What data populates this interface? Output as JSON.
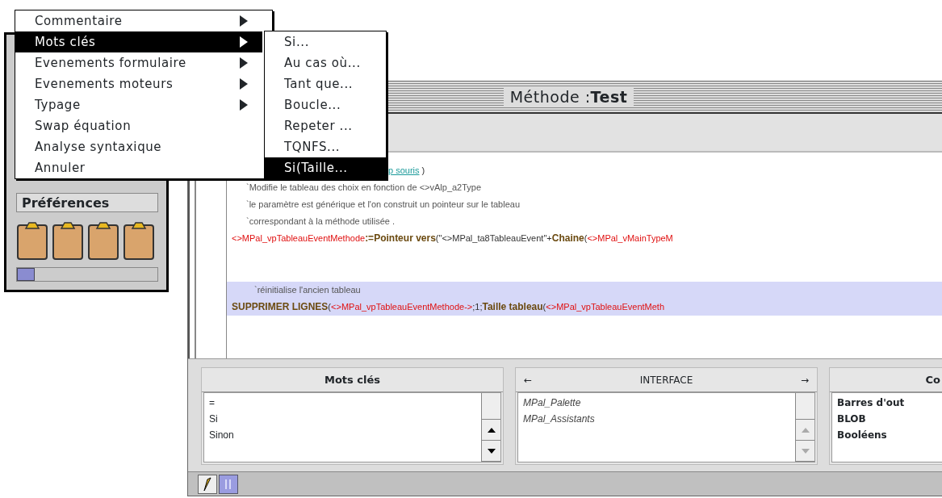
{
  "palette": {
    "title": "Préférences",
    "tools": [
      {
        "kind": "clipboard"
      },
      {
        "kind": "clipboard"
      },
      {
        "kind": "clipboard"
      },
      {
        "kind": "clipboard"
      }
    ]
  },
  "method_window": {
    "title_prefix": "Méthode :",
    "title_name": "Test",
    "code_lines": [
      {
        "kind": "code",
        "highlighted": false,
        "segments": [
          {
            "kind": "link",
            "text": "p souris"
          },
          {
            "kind": "plain",
            "text": " )"
          }
        ]
      },
      {
        "kind": "comment",
        "highlighted": false,
        "segments": [
          {
            "kind": "comment",
            "text": "`Modifie le tableau des choix en fonction de  <>vAlp_a2Type"
          }
        ]
      },
      {
        "kind": "comment",
        "highlighted": false,
        "segments": [
          {
            "kind": "comment",
            "text": "`le paramètre est générique et l'on construit un pointeur sur le tableau"
          }
        ]
      },
      {
        "kind": "comment",
        "highlighted": false,
        "segments": [
          {
            "kind": "comment",
            "text": "`correspondant à la méthode utilisée ."
          }
        ]
      },
      {
        "kind": "code",
        "highlighted": false,
        "segments": [
          {
            "kind": "variable",
            "text": "<>MPal_vpTableauEventMethode"
          },
          {
            "kind": "keyword",
            "text": ":=Pointeur vers"
          },
          {
            "kind": "plain",
            "text": "(\"<>MPal_ta8TableauEvent\"+"
          },
          {
            "kind": "keyword",
            "text": "Chaine"
          },
          {
            "kind": "plain",
            "text": "("
          },
          {
            "kind": "variable",
            "text": "<>MPal_vMainTypeM"
          }
        ]
      },
      {
        "kind": "comment",
        "highlighted": true,
        "segments": [
          {
            "kind": "comment",
            "text": "`réinitialise l'ancien tableau"
          }
        ]
      },
      {
        "kind": "code",
        "highlighted": true,
        "segments": [
          {
            "kind": "keyword",
            "text": "SUPPRIMER LIGNES"
          },
          {
            "kind": "plain",
            "text": "("
          },
          {
            "kind": "variable",
            "text": "<>MPal_vpTableauEventMethode->"
          },
          {
            "kind": "plain",
            "text": ";1;"
          },
          {
            "kind": "keyword",
            "text": "Taille tableau"
          },
          {
            "kind": "plain",
            "text": "("
          },
          {
            "kind": "variable",
            "text": "<>MPal_vpTableauEventMeth"
          }
        ]
      }
    ],
    "panes": [
      {
        "title": "Mots clés",
        "kind": "plain",
        "scroll_enabled": true,
        "items": [
          "=",
          "Si",
          "Sinon"
        ]
      },
      {
        "title": "INTERFACE",
        "prev": "←",
        "next": "→",
        "kind": "italic",
        "scroll_enabled": false,
        "items": [
          "MPal_Palette",
          "MPal_Assistants"
        ]
      },
      {
        "title": "Co",
        "kind": "bold",
        "items": [
          "Barres d'out",
          "BLOB",
          "Booléens"
        ]
      }
    ]
  },
  "menu": {
    "items": [
      {
        "label": "Commentaire",
        "submenu": true,
        "selected": false
      },
      {
        "label": "Mots clés",
        "submenu": true,
        "selected": true
      },
      {
        "label": "Evenements formulaire",
        "submenu": true,
        "selected": false
      },
      {
        "label": "Evenements moteurs",
        "submenu": true,
        "selected": false
      },
      {
        "label": "Typage",
        "submenu": true,
        "selected": false
      },
      {
        "label": "Swap équation",
        "submenu": false,
        "selected": false
      },
      {
        "label": "Analyse syntaxique",
        "submenu": false,
        "selected": false
      },
      {
        "label": "Annuler",
        "submenu": false,
        "selected": false
      }
    ]
  },
  "submenu": {
    "items": [
      {
        "label": "Si...",
        "selected": false
      },
      {
        "label": "Au cas où...",
        "selected": false
      },
      {
        "label": "Tant que...",
        "selected": false
      },
      {
        "label": "Boucle...",
        "selected": false
      },
      {
        "label": "Repeter ...",
        "selected": false
      },
      {
        "label": "TQNFS...",
        "selected": false
      },
      {
        "label": "Si(Taille...",
        "selected": true
      }
    ]
  }
}
